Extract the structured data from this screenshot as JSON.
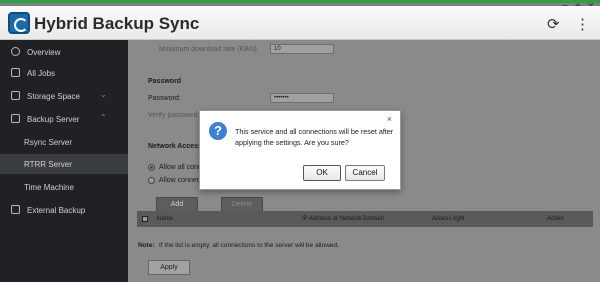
{
  "window": {
    "minimize": "−",
    "maximize": "+",
    "close": "×"
  },
  "app": {
    "title": "Hybrid Backup Sync",
    "refresh_icon": "refresh-icon",
    "more_icon": "more-vertical-icon"
  },
  "sidebar": {
    "items": [
      {
        "label": "Overview",
        "icon": "overview-icon"
      },
      {
        "label": "All Jobs",
        "icon": "jobs-icon"
      },
      {
        "label": "Storage Space",
        "icon": "storage-icon"
      },
      {
        "label": "Backup Server",
        "icon": "backup-server-icon"
      },
      {
        "label": "Rsync Server"
      },
      {
        "label": "RTRR Server",
        "active": true
      },
      {
        "label": "Time Machine"
      },
      {
        "label": "External Backup",
        "icon": "external-backup-icon"
      }
    ]
  },
  "main": {
    "max_download_label": "Maximum download rate (KB/s):",
    "max_download_value": "10",
    "password_section": "Password",
    "password_label": "Password:",
    "password_value": "•••••••",
    "verify_label": "Verify password:",
    "network_section": "Network Access P",
    "radio_allow_all": "Allow all conne",
    "radio_allow_conn": "Allow connect",
    "add_button": "Add",
    "delete_button": "Delete",
    "table_headers": [
      "Name",
      "IP Address or Network Domain",
      "Access right",
      "Action"
    ],
    "note_prefix": "Note:",
    "note_text": "If the list is empty, all connections to the server will be allowed.",
    "apply_button": "Apply"
  },
  "dialog": {
    "message": "This service and all connections will be reset after applying the settings. Are you sure?",
    "ok": "OK",
    "cancel": "Cancel",
    "close": "×"
  }
}
